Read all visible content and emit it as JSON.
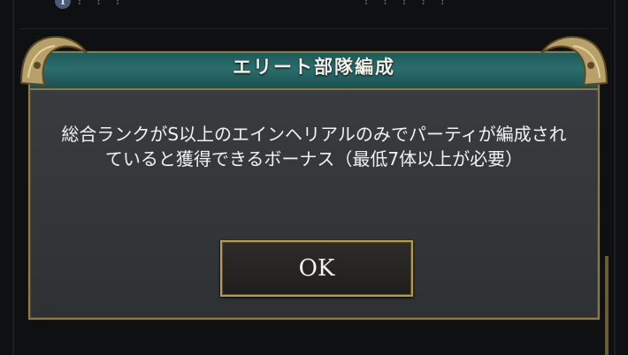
{
  "background": {
    "info_icon": "i",
    "row1_left": "? ? ?",
    "row1_right": "? ? ? ? ?"
  },
  "dialog": {
    "title": "エリート部隊編成",
    "message": "総合ランクがS以上のエインヘリアルのみでパーティが編成されていると獲得できるボーナス（最低7体以上が必要）",
    "ok_label": "OK",
    "colors": {
      "header": "#236463",
      "border_gold": "#8c7a4e",
      "body": "#36393c"
    }
  }
}
